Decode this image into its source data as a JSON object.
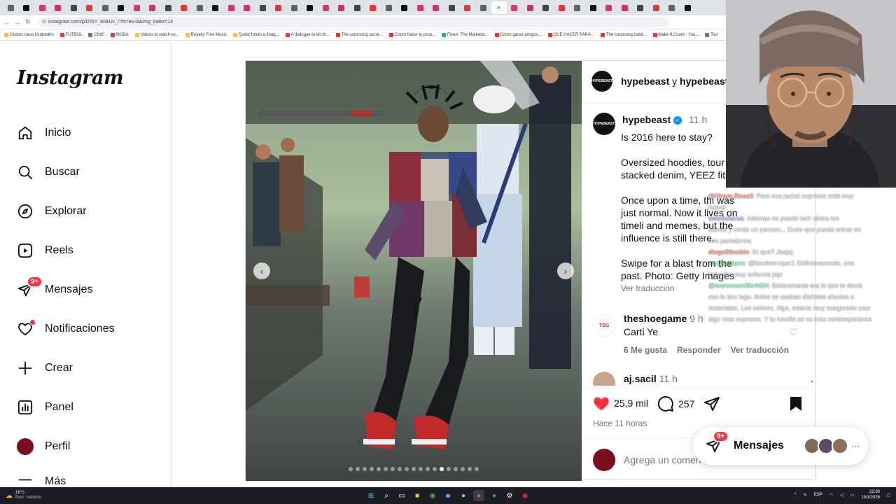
{
  "browser": {
    "tab_count": 44,
    "url": "instagram.com/p/DTsY_bNkUc_/?hl=es-la&img_index=14",
    "bookmarks": [
      "Gustos raros lordpedrin",
      "FÚTBOL",
      "CINE",
      "MODA",
      "Videos to watch ev...",
      "Royalty Free Music",
      "Quitar fondo a imag...",
      "A dialogue to kill th...",
      "The surprising secre...",
      "Cómo hacer tu prop...",
      "Fiverr: The Marketpl...",
      "Cómo ganar amigos...",
      "QUÉ HACER PARA...",
      "The surprising habit...",
      "Make It Count - You...",
      "Tod"
    ]
  },
  "sidebar": {
    "logo": "Instagram",
    "items": [
      {
        "label": "Inicio",
        "icon": "home-icon"
      },
      {
        "label": "Buscar",
        "icon": "search-icon"
      },
      {
        "label": "Explorar",
        "icon": "compass-icon"
      },
      {
        "label": "Reels",
        "icon": "reels-icon"
      },
      {
        "label": "Mensajes",
        "icon": "messenger-icon",
        "badge": "9+"
      },
      {
        "label": "Notificaciones",
        "icon": "heart-icon"
      },
      {
        "label": "Crear",
        "icon": "plus-icon"
      },
      {
        "label": "Panel",
        "icon": "chart-icon"
      },
      {
        "label": "Perfil",
        "icon": "avatar-icon"
      },
      {
        "label": "Más",
        "icon": "menu-icon"
      }
    ]
  },
  "post": {
    "header_user": "hypebeast",
    "header_connector": "y",
    "header_user2": "hypebeast",
    "avatar_text": "HYPEBEAST",
    "author": "hypebeast",
    "time": "11 h",
    "caption": [
      "Is 2016 here to stay?",
      "Oversized hoodies, tour and stacked denim, YEEZ fits.",
      "Once upon a time, thi was just normal. Now it lives on timeli and memes, but the influence is still there.",
      "Swipe for a blast from the past. Photo: Getty Images"
    ],
    "translate": "Ver traducción",
    "comments": [
      {
        "user": "theshoegame",
        "time": "9 h",
        "text": "Carti Ye",
        "likes": "6 Me gusta",
        "reply": "Responder",
        "translate": "Ver traducción"
      },
      {
        "user": "aj.sacil",
        "time": "11 h"
      }
    ],
    "likes_count": "25,9 mil",
    "comments_count": "257",
    "posted": "Hace 11 horas",
    "add_comment_placeholder": "Agrega un comen",
    "carousel_total": 19,
    "carousel_index": 14
  },
  "floating": {
    "label": "Mensajes",
    "badge": "9+",
    "more": "···"
  },
  "chat": [
    {
      "user": "@Hiram.Rossii",
      "text": ": Pero esa jacket supreme está muy"
    },
    {
      "user": "",
      "text": "nueva"
    },
    {
      "user": "woodstarus",
      "text": ": Ademas no puedo lucir ahora los"
    },
    {
      "user": "",
      "text": "blanco y verde un panzon... Dudo que pueda entrar en"
    },
    {
      "user": "",
      "text": "eso pantalones"
    },
    {
      "user": "diego06noble",
      "text": ": Et que? Jaaja)"
    },
    {
      "user": "ampsaolana",
      "text": ": @fossilverviper1 Definitivamente, una"
    },
    {
      "user": "",
      "text": "industria muy enferma jaja"
    },
    {
      "user": "@marcocarrillo4424",
      "text": ": Básicamente era lo que te decía"
    },
    {
      "user": "",
      "text": "con la box logo. Antes se usaban distintas siluetas o"
    },
    {
      "user": "",
      "text": "materiales. Los colores, digo, estaría muy exagerado usar"
    },
    {
      "user": "",
      "text": "algo rosa supreme. Y tu hoodie se ve más contemporánea"
    }
  ],
  "taskbar": {
    "weather_temp": "16°C",
    "weather_desc": "Parc. nublado",
    "lang": "ESP",
    "time": "22:30",
    "date": "19/1/2026"
  },
  "colors": {
    "heart": "#ff3040",
    "link": "#00376b",
    "muted": "#737373",
    "border": "#dbdbdb"
  }
}
